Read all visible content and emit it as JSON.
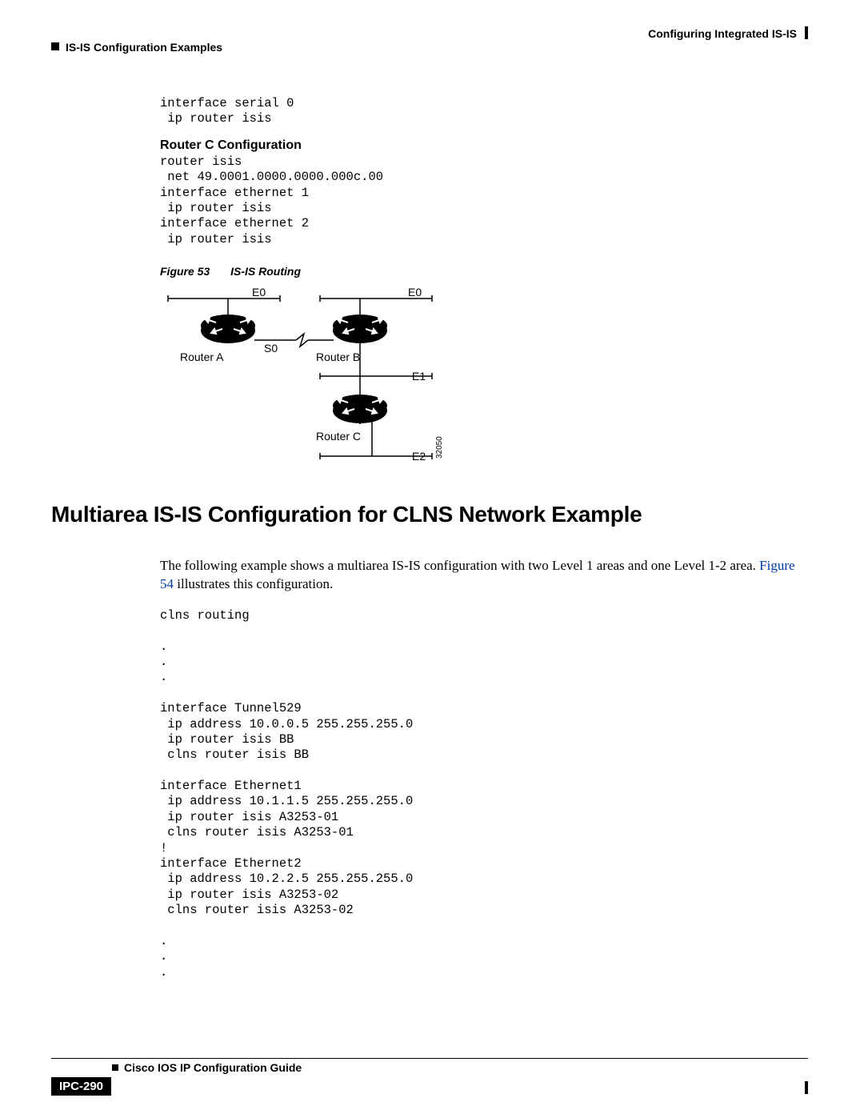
{
  "header": {
    "right": "Configuring Integrated IS-IS",
    "left": "IS-IS Configuration Examples"
  },
  "block1_code": "interface serial 0\n ip router isis",
  "router_c_heading": "Router C Configuration",
  "router_c_code": "router isis\n net 49.0001.0000.0000.000c.00\ninterface ethernet 1\n ip router isis\ninterface ethernet 2\n ip router isis",
  "figure": {
    "label": "Figure 53",
    "title": "IS-IS Routing",
    "labels": {
      "e0a": "E0",
      "e0b": "E0",
      "s0": "S0",
      "ra": "Router A",
      "rb": "Router B",
      "e1": "E1",
      "rc": "Router C",
      "e2": "E2",
      "id": "32050"
    }
  },
  "section_title": "Multiarea IS-IS Configuration for CLNS Network Example",
  "para_pre": "The following example shows a multiarea IS-IS configuration with two Level 1 areas and one Level 1-2 area. ",
  "para_link": "Figure 54",
  "para_post": " illustrates this configuration.",
  "block2_code": "clns routing\n\n.\n.\n.\n\ninterface Tunnel529\n ip address 10.0.0.5 255.255.255.0\n ip router isis BB\n clns router isis BB\n\ninterface Ethernet1\n ip address 10.1.1.5 255.255.255.0\n ip router isis A3253-01\n clns router isis A3253-01\n!\ninterface Ethernet2\n ip address 10.2.2.5 255.255.255.0\n ip router isis A3253-02\n clns router isis A3253-02\n\n.\n.\n.",
  "footer": {
    "guide": "Cisco IOS IP Configuration Guide",
    "page": "IPC-290"
  }
}
